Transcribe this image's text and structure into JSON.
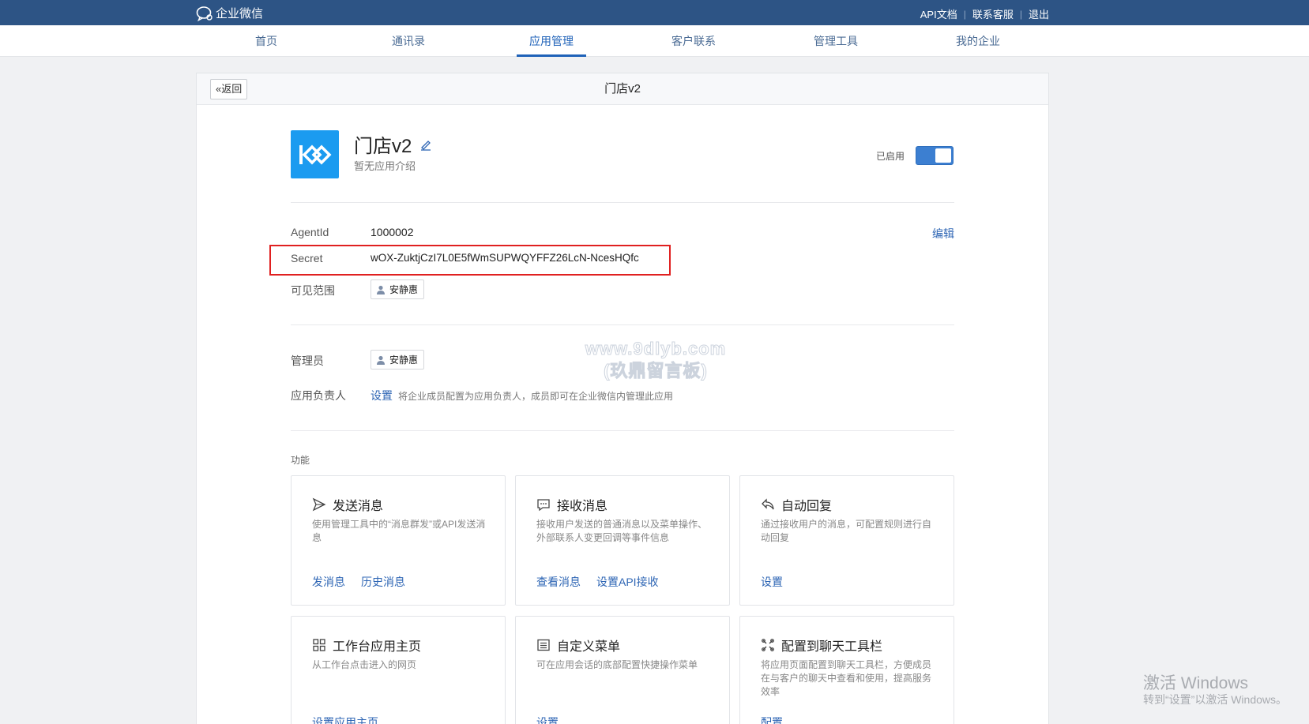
{
  "topbar": {
    "brand": "企业微信",
    "links": [
      "API文档",
      "联系客服",
      "退出"
    ]
  },
  "nav": {
    "items": [
      "首页",
      "通讯录",
      "应用管理",
      "客户联系",
      "管理工具",
      "我的企业"
    ],
    "active": "应用管理"
  },
  "panel": {
    "back_label": "返回",
    "title": "门店v2"
  },
  "app": {
    "name": "门店v2",
    "description": "暂无应用介绍",
    "status_label": "已启用",
    "enabled": true
  },
  "info": {
    "agentid_label": "AgentId",
    "agentid_value": "1000002",
    "edit_label": "编辑",
    "secret_label": "Secret",
    "secret_value": "wOX-ZuktjCzI7L0E5fWmSUPWQYFFZ26LcN-NcesHQfc",
    "scope_label": "可见范围",
    "scope_user": "安静惠"
  },
  "admin": {
    "admin_label": "管理员",
    "admin_user": "安静惠",
    "owner_label": "应用负责人",
    "owner_link": "设置",
    "owner_hint": "将企业成员配置为应用负责人，成员即可在企业微信内管理此应用"
  },
  "features": {
    "title": "功能",
    "cards": [
      {
        "title": "发送消息",
        "icon": "send-icon",
        "desc": "使用管理工具中的“消息群发”或API发送消息",
        "links": [
          "发消息",
          "历史消息"
        ]
      },
      {
        "title": "接收消息",
        "icon": "chat-bubble-icon",
        "desc": "接收用户发送的普通消息以及菜单操作、外部联系人变更回调等事件信息",
        "links": [
          "查看消息",
          "设置API接收"
        ]
      },
      {
        "title": "自动回复",
        "icon": "reply-icon",
        "desc": "通过接收用户的消息，可配置规则进行自动回复",
        "links": [
          "设置"
        ]
      },
      {
        "title": "工作台应用主页",
        "icon": "grid-icon",
        "desc": "从工作台点击进入的网页",
        "links": [
          "设置应用主页"
        ]
      },
      {
        "title": "自定义菜单",
        "icon": "menu-icon",
        "desc": "可在应用会话的底部配置快捷操作菜单",
        "links": [
          "设置"
        ]
      },
      {
        "title": "配置到聊天工具栏",
        "icon": "toolbar-icon",
        "desc": "将应用页面配置到聊天工具栏，方便成员在与客户的聊天中查看和使用，提高服务效率",
        "links": [
          "配置"
        ]
      }
    ]
  },
  "watermark": {
    "line1": "www.9dlyb.com",
    "line2": "(玖鼎留言板)"
  },
  "os_overlay": {
    "title": "激活 Windows",
    "subtitle": "转到“设置”以激活 Windows。"
  }
}
